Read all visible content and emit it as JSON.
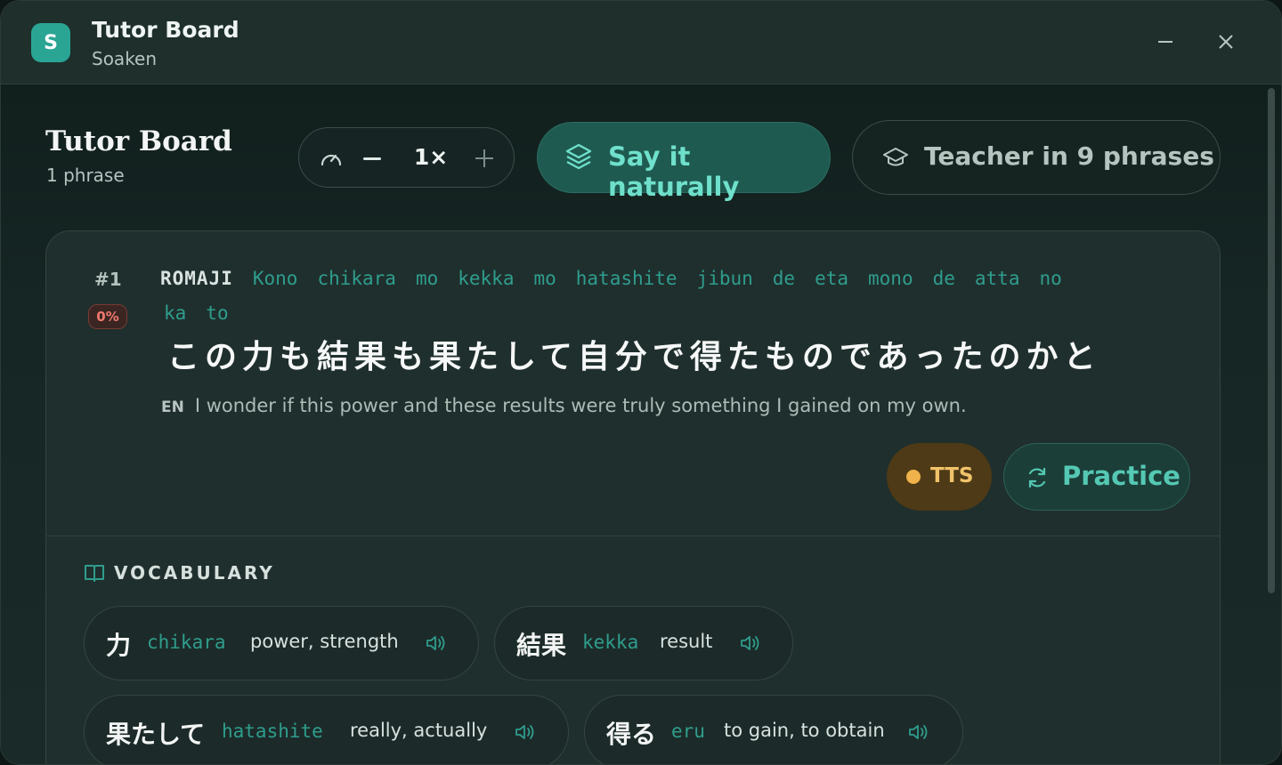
{
  "window": {
    "app_icon_letter": "S",
    "title": "Tutor Board",
    "subtitle": "Soaken"
  },
  "header": {
    "title": "Tutor Board",
    "subtitle": "1 phrase",
    "speed": "1×",
    "say_naturally": "Say it naturally",
    "teacher": "Teacher in 9 phrases"
  },
  "phrase": {
    "number": "#1",
    "progress": "0%",
    "romaji_label": "ROMAJI",
    "romaji_words": [
      "Kono",
      "chikara",
      "mo",
      "kekka",
      "mo",
      "hatashite",
      "jibun",
      "de",
      "eta",
      "mono",
      "de",
      "atta",
      "no",
      "ka",
      "to"
    ],
    "japanese": "この力も結果も果たして自分で得たものであったのかと",
    "en_label": "EN",
    "english": "I wonder if this power and these results were truly something I gained on my own.",
    "tts_label": "TTS",
    "practice_label": "Practice"
  },
  "vocabulary": {
    "heading": "VOCABULARY",
    "items": [
      {
        "kanji": "力",
        "romaji": "chikara",
        "meaning": "power, strength"
      },
      {
        "kanji": "結果",
        "romaji": "kekka",
        "meaning": "result"
      },
      {
        "kanji": "果たして",
        "romaji": "hatashite",
        "meaning": "really, actually"
      },
      {
        "kanji": "得る",
        "romaji": "eru",
        "meaning": "to gain, to obtain"
      }
    ]
  },
  "colors": {
    "accent": "#2aa594",
    "romaji": "#2f9d8d",
    "tts": "#f0b24a",
    "progress_low": "#f07a6d"
  }
}
